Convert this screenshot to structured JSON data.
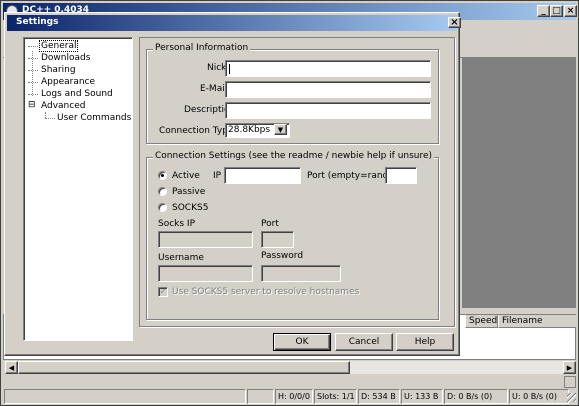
{
  "main_window": {
    "title": "DC++ 0.4034",
    "min_glyph": "_",
    "max_glyph": "□",
    "close_glyph": "×",
    "transfer_headers": [
      "Speed",
      "Filename"
    ],
    "left_header_fragment": "U",
    "status": {
      "hubs": "H: 0/0/0",
      "slots": "Slots: 1/1",
      "downloaded": "D: 534 B",
      "uploaded": "U: 133 B",
      "down_speed": "D: 0 B/s (0)",
      "up_speed": "U: 0 B/s (0)"
    }
  },
  "dialog": {
    "title": "Settings",
    "close_glyph": "×",
    "tree": {
      "items": [
        {
          "label": "General",
          "selected": true
        },
        {
          "label": "Downloads"
        },
        {
          "label": "Sharing"
        },
        {
          "label": "Appearance"
        },
        {
          "label": "Logs and Sound"
        },
        {
          "label": "Advanced",
          "expander": "⊟"
        },
        {
          "label": "User Commands"
        }
      ]
    },
    "personal": {
      "title": "Personal Information",
      "nick_label": "Nick",
      "nick_value": "",
      "email_label": "E-Mail",
      "email_value": "",
      "description_label": "Description",
      "description_value": "",
      "connection_type_label": "Connection Type",
      "connection_type_value": "28.8Kbps"
    },
    "connection": {
      "title": "Connection Settings (see the readme / newbie help if unsure)",
      "active_label": "Active",
      "passive_label": "Passive",
      "socks5_label": "SOCKS5",
      "selected_mode": "Active",
      "ip_label": "IP",
      "ip_value": "",
      "port_label": "Port (empty=random)",
      "port_value": "",
      "socks_ip_label": "Socks IP",
      "socks_port_label": "Port",
      "username_label": "Username",
      "password_label": "Password",
      "resolve_label": "Use SOCKS5 server to resolve hostnames",
      "resolve_checked": true
    },
    "buttons": {
      "ok": "OK",
      "cancel": "Cancel",
      "help": "Help"
    }
  }
}
